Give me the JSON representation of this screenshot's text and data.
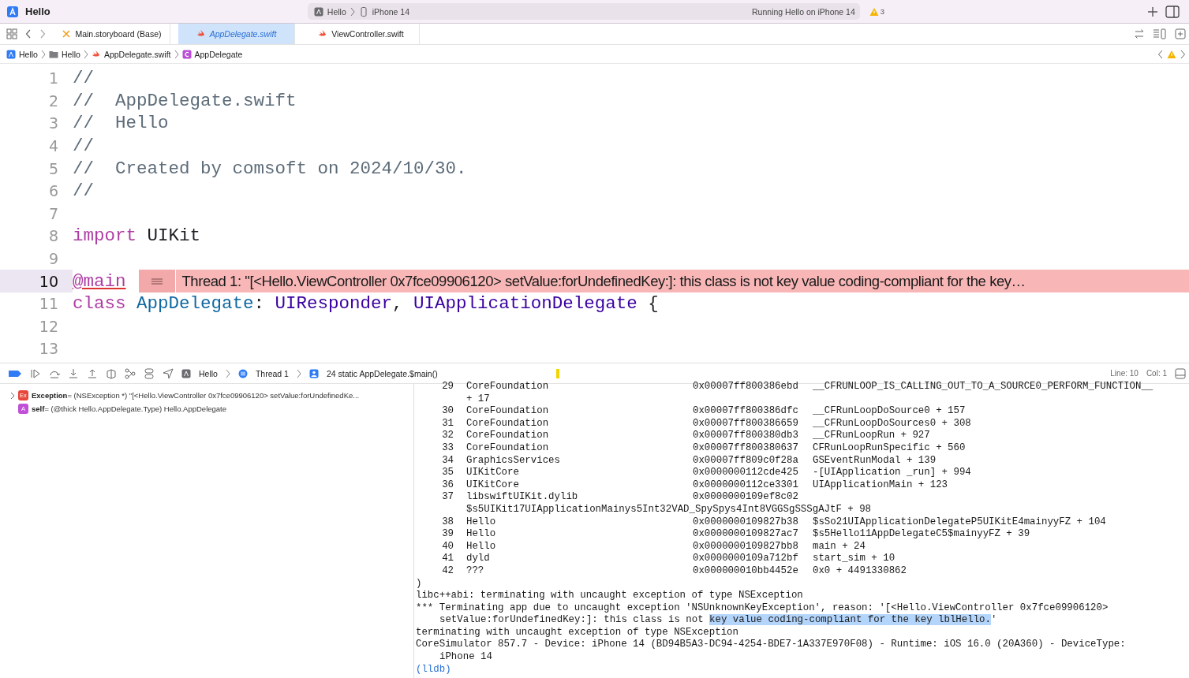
{
  "titlebar": {
    "project": "Hello",
    "scheme": "Hello",
    "device": "iPhone 14",
    "status": "Running Hello on iPhone 14",
    "warnings": "3"
  },
  "tabs": [
    {
      "label": "Main.storyboard (Base)",
      "kind": "storyboard",
      "selected": false
    },
    {
      "label": "AppDelegate.swift",
      "kind": "swift",
      "selected": true
    },
    {
      "label": "ViewController.swift",
      "kind": "swift",
      "selected": false
    }
  ],
  "breadcrumbs": [
    {
      "label": "Hello",
      "kind": "project"
    },
    {
      "label": "Hello",
      "kind": "folder"
    },
    {
      "label": "AppDelegate.swift",
      "kind": "swift"
    },
    {
      "label": "AppDelegate",
      "kind": "class"
    }
  ],
  "editor": {
    "lines": [
      {
        "number": "1",
        "current": false,
        "tokens": [
          {
            "text": "//",
            "kind": "comment"
          }
        ]
      },
      {
        "number": "2",
        "current": false,
        "tokens": [
          {
            "text": "//  AppDelegate.swift",
            "kind": "comment"
          }
        ]
      },
      {
        "number": "3",
        "current": false,
        "tokens": [
          {
            "text": "//  Hello",
            "kind": "comment"
          }
        ]
      },
      {
        "number": "4",
        "current": false,
        "tokens": [
          {
            "text": "//",
            "kind": "comment"
          }
        ]
      },
      {
        "number": "5",
        "current": false,
        "tokens": [
          {
            "text": "//  Created by comsoft on 2024/10/30.",
            "kind": "comment"
          }
        ]
      },
      {
        "number": "6",
        "current": false,
        "tokens": [
          {
            "text": "//",
            "kind": "comment"
          }
        ]
      },
      {
        "number": "7",
        "current": false
      },
      {
        "number": "8",
        "current": false,
        "tokens": [
          {
            "text": "import",
            "kind": "keyword"
          },
          {
            "text": " UIKit",
            "kind": "plain"
          }
        ]
      },
      {
        "number": "9",
        "current": false
      },
      {
        "number": "10",
        "current": true,
        "tokens": [
          {
            "text": "@main",
            "kind": "attribute"
          }
        ],
        "issue": "Thread 1: \"[<Hello.ViewController 0x7fce09906120> setValue:forUndefinedKey:]: this class is not key value coding-compliant for the key…"
      },
      {
        "number": "11",
        "current": false,
        "tokens": [
          {
            "text": "class ",
            "kind": "keyword"
          },
          {
            "text": "AppDelegate",
            "kind": "declaration"
          },
          {
            "text": ": ",
            "kind": "plain"
          },
          {
            "text": "UIResponder",
            "kind": "type"
          },
          {
            "text": ", ",
            "kind": "plain"
          },
          {
            "text": "UIApplicationDelegate",
            "kind": "type"
          },
          {
            "text": " {",
            "kind": "plain"
          }
        ]
      },
      {
        "number": "12",
        "current": false
      },
      {
        "number": "13",
        "current": false
      }
    ]
  },
  "debug_bar": {
    "breadcrumbs": [
      {
        "label": "Hello",
        "kind": "project"
      },
      {
        "label": "Thread 1",
        "kind": "thread"
      },
      {
        "label": "24 static AppDelegate.$main()",
        "kind": "frame"
      }
    ],
    "line": "Line: 10",
    "col": "Col: 1"
  },
  "variables": [
    {
      "expandable": true,
      "badge": "Ex",
      "color": "#e8473c",
      "name": "Exception",
      "value": " = (NSException *) \"[<Hello.ViewController 0x7fce09906120> setValue:forUndefinedKe..."
    },
    {
      "expandable": false,
      "badge": "A",
      "color": "#c050d8",
      "name": "self",
      "value": " = (@thick Hello.AppDelegate.Type) Hello.AppDelegate"
    }
  ],
  "console": {
    "frames": [
      {
        "number": "29",
        "library": "CoreFoundation",
        "address": "0x00007ff800386ebd",
        "symbol": "__CFRUNLOOP_IS_CALLING_OUT_TO_A_SOURCE0_PERFORM_FUNCTION__",
        "continuation": "+ 17"
      },
      {
        "number": "30",
        "library": "CoreFoundation",
        "address": "0x00007ff800386dfc",
        "symbol": "__CFRunLoopDoSource0 + 157"
      },
      {
        "number": "31",
        "library": "CoreFoundation",
        "address": "0x00007ff800386659",
        "symbol": "__CFRunLoopDoSources0 + 308"
      },
      {
        "number": "32",
        "library": "CoreFoundation",
        "address": "0x00007ff800380db3",
        "symbol": "__CFRunLoopRun + 927"
      },
      {
        "number": "33",
        "library": "CoreFoundation",
        "address": "0x00007ff800380637",
        "symbol": "CFRunLoopRunSpecific + 560"
      },
      {
        "number": "34",
        "library": "GraphicsServices",
        "address": "0x00007ff809c0f28a",
        "symbol": "GSEventRunModal + 139"
      },
      {
        "number": "35",
        "library": "UIKitCore",
        "address": "0x0000000112cde425",
        "symbol": "-[UIApplication _run] + 994"
      },
      {
        "number": "36",
        "library": "UIKitCore",
        "address": "0x0000000112ce3301",
        "symbol": "UIApplicationMain + 123"
      },
      {
        "number": "37",
        "library": "libswiftUIKit.dylib",
        "address": "0x0000000109ef8c02",
        "continuation": "$s5UIKit17UIApplicationMainys5Int32VAD_SpySpys4Int8VGGSgSSSgAJtF + 98"
      },
      {
        "number": "38",
        "library": "Hello",
        "address": "0x0000000109827b38",
        "symbol": "$sSo21UIApplicationDelegateP5UIKitE4mainyyFZ + 104"
      },
      {
        "number": "39",
        "library": "Hello",
        "address": "0x0000000109827ac7",
        "symbol": "$s5Hello11AppDelegateC5$mainyyFZ + 39"
      },
      {
        "number": "40",
        "library": "Hello",
        "address": "0x0000000109827bb8",
        "symbol": "main + 24"
      },
      {
        "number": "41",
        "library": "dyld",
        "address": "0x0000000109a712bf",
        "symbol": "start_sim + 10"
      },
      {
        "number": "42",
        "library": "???",
        "address": "0x000000010bb4452e",
        "symbol": "0x0 + 4491330862"
      }
    ],
    "log": [
      {
        "kind": "line",
        "parts": [
          {
            "text": ")",
            "selected": false
          }
        ]
      },
      {
        "kind": "line",
        "parts": [
          {
            "text": "libc++abi: terminating with uncaught exception of type NSException",
            "selected": false
          }
        ]
      },
      {
        "kind": "line",
        "parts": [
          {
            "text": "*** Terminating app due to uncaught exception 'NSUnknownKeyException', reason: '[<Hello.ViewController 0x7fce09906120>",
            "selected": false
          }
        ]
      },
      {
        "kind": "continuation",
        "parts": [
          {
            "text": "setValue:forUndefinedKey:]: this class is not ",
            "selected": false
          },
          {
            "text": "key value coding-compliant for the key lblHello.",
            "selected": true
          },
          {
            "text": "'",
            "selected": false
          }
        ]
      },
      {
        "kind": "line",
        "parts": [
          {
            "text": "terminating with uncaught exception of type NSException",
            "selected": false
          }
        ]
      },
      {
        "kind": "line",
        "parts": [
          {
            "text": "CoreSimulator 857.7 - Device: iPhone 14 (BD94B5A3-DC94-4254-BDE7-1A337E970F08) - Runtime: iOS 16.0 (20A360) - DeviceType:",
            "selected": false
          }
        ]
      },
      {
        "kind": "continuation",
        "parts": [
          {
            "text": "iPhone 14",
            "selected": false
          }
        ]
      },
      {
        "kind": "prompt",
        "parts": [
          {
            "text": "(lldb)",
            "selected": false
          }
        ]
      }
    ]
  }
}
